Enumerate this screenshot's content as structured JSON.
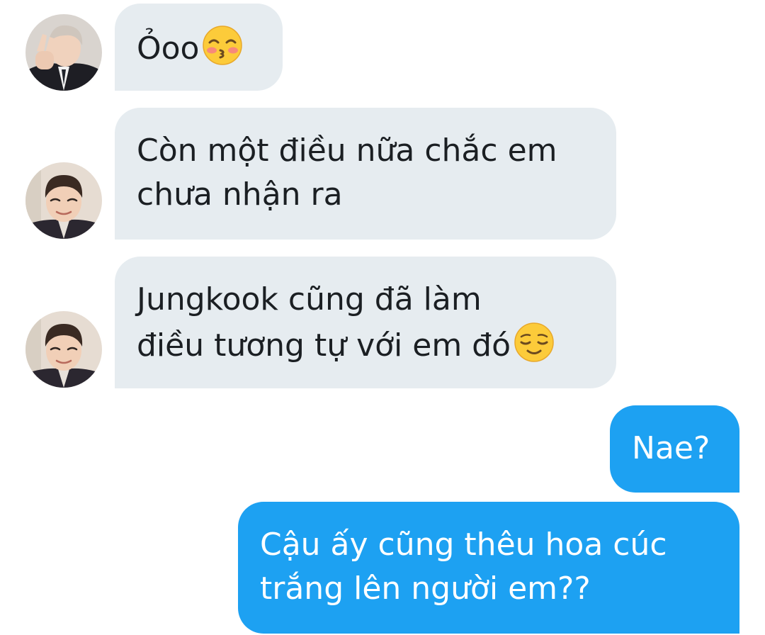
{
  "messages": [
    {
      "sender": "namjoon",
      "direction": "in",
      "lines": [
        "Ỏoo"
      ],
      "emoji": "kissing-smiling-eyes-emoji"
    },
    {
      "sender": "jin",
      "direction": "in",
      "lines": [
        "Còn một điều nữa chắc em",
        "chưa nhận ra"
      ]
    },
    {
      "sender": "jin",
      "direction": "in",
      "lines": [
        "Jungkook cũng đã làm",
        "điều tương tự với em đó"
      ],
      "emoji": "relieved-face-emoji"
    },
    {
      "sender": "me",
      "direction": "out",
      "lines": [
        "Nae?"
      ]
    },
    {
      "sender": "me",
      "direction": "out",
      "lines": [
        "Cậu ấy cũng thêu hoa cúc",
        "trắng lên người em??"
      ]
    }
  ],
  "colors": {
    "incoming_bubble": "#e6ecf0",
    "outgoing_bubble": "#1da1f2",
    "incoming_text": "#1b1f23",
    "outgoing_text": "#ffffff"
  }
}
